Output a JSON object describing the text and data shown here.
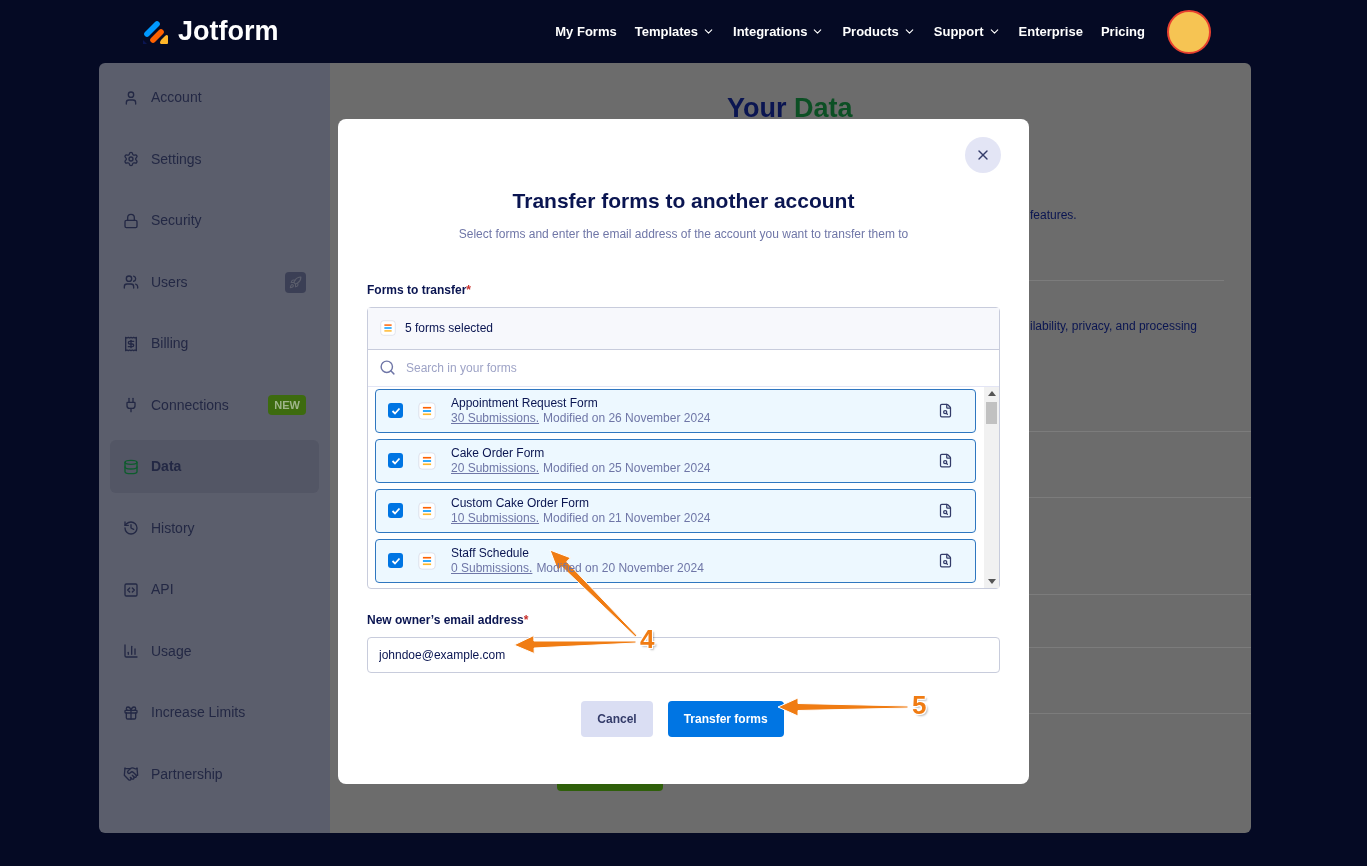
{
  "navbar": {
    "logo": "Jotform",
    "links": [
      {
        "label": "My Forms",
        "dropdown": false
      },
      {
        "label": "Templates",
        "dropdown": true
      },
      {
        "label": "Integrations",
        "dropdown": true
      },
      {
        "label": "Products",
        "dropdown": true
      },
      {
        "label": "Support",
        "dropdown": true
      },
      {
        "label": "Enterprise",
        "dropdown": false
      },
      {
        "label": "Pricing",
        "dropdown": false
      }
    ]
  },
  "sidebar": {
    "items": [
      {
        "label": "Account",
        "selected": false
      },
      {
        "label": "Settings",
        "selected": false
      },
      {
        "label": "Security",
        "selected": false
      },
      {
        "label": "Users",
        "selected": false,
        "badge": {
          "kind": "icon"
        }
      },
      {
        "label": "Billing",
        "selected": false
      },
      {
        "label": "Connections",
        "selected": false,
        "badge": {
          "kind": "text",
          "text": "NEW"
        }
      },
      {
        "label": "Data",
        "selected": true
      },
      {
        "label": "History",
        "selected": false
      },
      {
        "label": "API",
        "selected": false
      },
      {
        "label": "Usage",
        "selected": false
      },
      {
        "label": "Increase Limits",
        "selected": false
      },
      {
        "label": "Partnership",
        "selected": false
      }
    ]
  },
  "page": {
    "title": "Your",
    "title_accent": "Data",
    "fragments": [
      "features.",
      "ilability, privacy, and processing"
    ]
  },
  "modal": {
    "title": "Transfer forms to another account",
    "subtitle": "Select forms and enter the email address of the account you want to transfer them to",
    "forms_label": {
      "text": "Forms to transfer",
      "marker": "*"
    },
    "selected_summary": "5 forms selected",
    "search": {
      "placeholder": "Search in your forms"
    },
    "forms": [
      {
        "name": "Appointment Request Form",
        "submissions": "30 Submissions.",
        "modified": "Modified on 26 November 2024",
        "checked": true
      },
      {
        "name": "Cake Order Form",
        "submissions": "20 Submissions.",
        "modified": "Modified on 25 November 2024",
        "checked": true
      },
      {
        "name": "Custom Cake Order Form",
        "submissions": "10 Submissions.",
        "modified": "Modified on 21 November 2024",
        "checked": true
      },
      {
        "name": "Staff Schedule",
        "submissions": "0 Submissions.",
        "modified": "Modified on 20 November 2024",
        "checked": true
      }
    ],
    "email_label": {
      "text": "New owner’s email address",
      "marker": "*"
    },
    "email": {
      "value": "johndoe@example.com"
    },
    "buttons": [
      {
        "label": "Cancel",
        "kind": "secondary"
      },
      {
        "label": "Transfer forms",
        "kind": "primary"
      }
    ]
  },
  "annotations": [
    {
      "number": "4"
    },
    {
      "number": "5"
    }
  ]
}
